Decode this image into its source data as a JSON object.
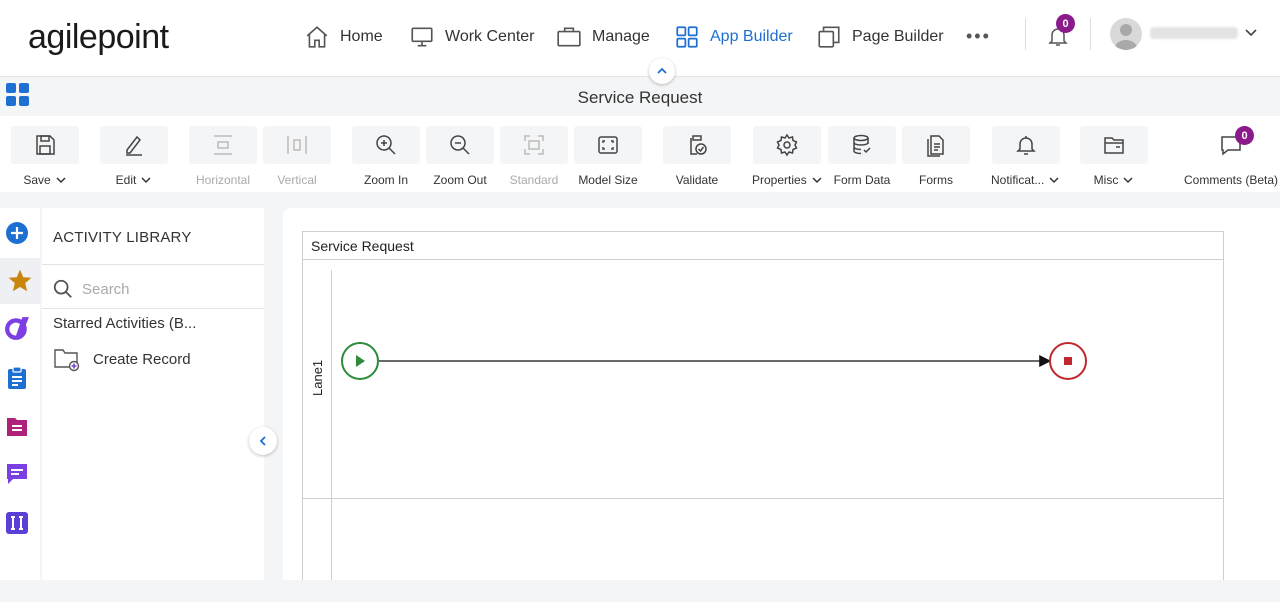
{
  "header": {
    "logo_text": "agilepoint",
    "nav": [
      {
        "label": "Home",
        "icon": "home-icon"
      },
      {
        "label": "Work Center",
        "icon": "monitor-icon"
      },
      {
        "label": "Manage",
        "icon": "briefcase-icon"
      },
      {
        "label": "App Builder",
        "icon": "grid-icon",
        "active": true
      },
      {
        "label": "Page Builder",
        "icon": "pages-icon"
      }
    ],
    "more": "•••",
    "notification_count": "0"
  },
  "title_bar": {
    "title": "Service Request"
  },
  "toolbar": {
    "buttons": [
      {
        "label": "Save",
        "dropdown": true
      },
      {
        "label": "Edit",
        "dropdown": true
      },
      {
        "label": "Horizontal",
        "disabled": true
      },
      {
        "label": "Vertical",
        "disabled": true
      },
      {
        "label": "Zoom In"
      },
      {
        "label": "Zoom Out"
      },
      {
        "label": "Standard",
        "disabled": true
      },
      {
        "label": "Model Size"
      },
      {
        "label": "Validate"
      },
      {
        "label": "Properties",
        "dropdown": true
      },
      {
        "label": "Form Data"
      },
      {
        "label": "Forms"
      },
      {
        "label": "Notificat...",
        "dropdown": true
      },
      {
        "label": "Misc",
        "dropdown": true
      },
      {
        "label": "Comments (Beta)",
        "badge": "0"
      }
    ]
  },
  "library": {
    "title": "ACTIVITY LIBRARY",
    "search_placeholder": "Search",
    "section": "Starred Activities (B...",
    "items": [
      {
        "label": "Create Record",
        "icon": "folder-plus-icon"
      }
    ]
  },
  "canvas": {
    "pool_title": "Service Request",
    "lanes": [
      {
        "label": "Lane1"
      },
      {
        "label": ""
      }
    ]
  },
  "colors": {
    "accent": "#1d6fd1",
    "badge": "#8b1a8b",
    "start_event": "#2e8b3a",
    "end_event": "#c0282d"
  }
}
